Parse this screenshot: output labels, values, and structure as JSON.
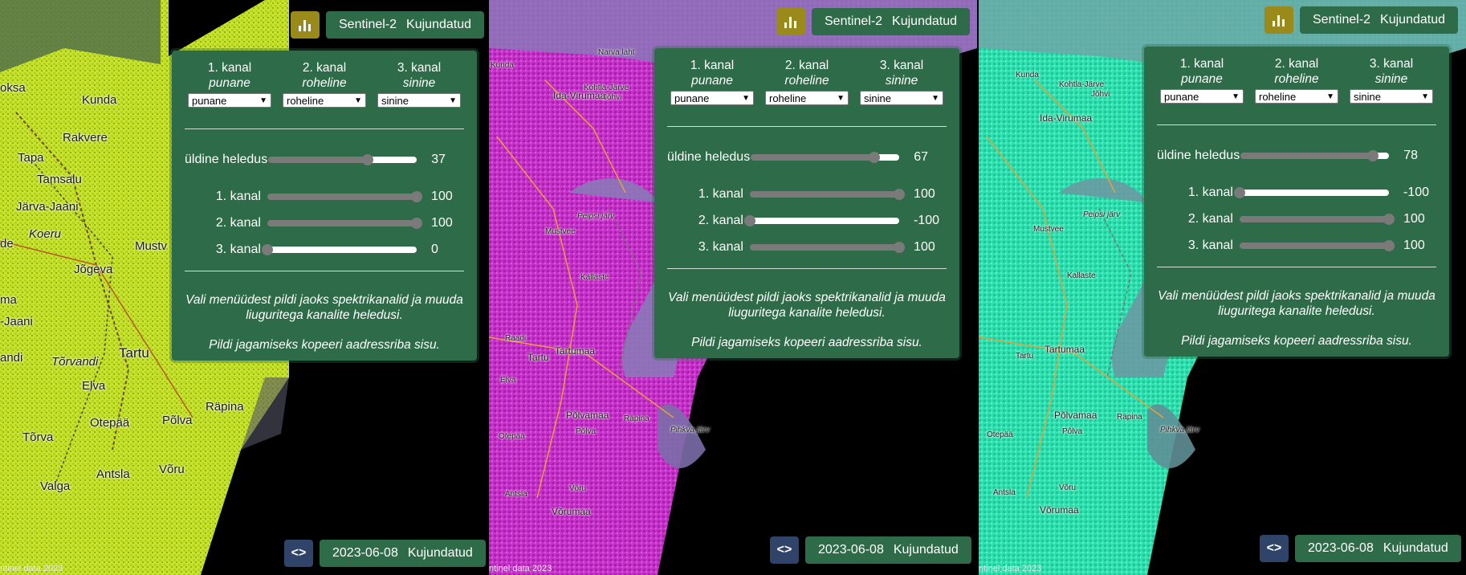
{
  "panels": [
    {
      "top": {
        "sensor": "Sentinel-2",
        "mode": "Kujundatud"
      },
      "bottom": {
        "date": "2023-06-08",
        "mode": "Kujundatud"
      },
      "channels": [
        {
          "title": "1. kanal",
          "name": "punane",
          "selected": "punane"
        },
        {
          "title": "2. kanal",
          "name": "roheline",
          "selected": "roheline"
        },
        {
          "title": "3. kanal",
          "name": "sinine",
          "selected": "sinine"
        }
      ],
      "brightness": {
        "label": "üldine heledus",
        "value": "37",
        "fraction": 0.67
      },
      "sliders": [
        {
          "label": "1. kanal",
          "value": "100",
          "fraction": 1.0
        },
        {
          "label": "2. kanal",
          "value": "100",
          "fraction": 1.0
        },
        {
          "label": "3. kanal",
          "value": "0",
          "fraction": 0.0
        }
      ],
      "desc1": "Vali menüüdest pildi jaoks spektrikanalid ja muuda liuguritega kanalite heledusi.",
      "desc2": "Pildi jagamiseks kopeeri aadressriba sisu.",
      "attribution": "ntinel data 2023",
      "places": [
        "Kunda",
        "Rakvere",
        "oksa",
        "Tapa",
        "Tamsalu",
        "Järva-Jaani",
        "Koeru",
        "Mustv",
        "Jõgeva",
        "Tartu",
        "Tõrvandi",
        "Elva",
        "Põlva",
        "Otepää",
        "Räpina",
        "Tõrva",
        "Antsla",
        "Võru",
        "Valga",
        "ma",
        "-Jaani",
        "andi",
        "de"
      ]
    },
    {
      "top": {
        "sensor": "Sentinel-2",
        "mode": "Kujundatud"
      },
      "bottom": {
        "date": "2023-06-08",
        "mode": "Kujundatud"
      },
      "channels": [
        {
          "title": "1. kanal",
          "name": "punane",
          "selected": "punane"
        },
        {
          "title": "2. kanal",
          "name": "roheline",
          "selected": "roheline"
        },
        {
          "title": "3. kanal",
          "name": "sinine",
          "selected": "sinine"
        }
      ],
      "brightness": {
        "label": "üldine heledus",
        "value": "67",
        "fraction": 0.83
      },
      "sliders": [
        {
          "label": "1. kanal",
          "value": "100",
          "fraction": 1.0
        },
        {
          "label": "2. kanal",
          "value": "-100",
          "fraction": 0.0
        },
        {
          "label": "3. kanal",
          "value": "100",
          "fraction": 1.0
        }
      ],
      "desc1": "Vali menüüdest pildi jaoks spektrikanalid ja muuda liuguritega kanalite heledusi.",
      "desc2": "Pildi jagamiseks kopeeri aadressriba sisu.",
      "attribution": "ntinel data 2023",
      "places": [
        "Narva laht",
        "Kunda",
        "Kohtla-Järve",
        "Jõhvi",
        "Ida-Virumaa",
        "Peipsi järv",
        "Mustvee",
        "Kallaste",
        "Tartu",
        "Tartumaa",
        "Põlvamaa",
        "Põlva",
        "Räpina",
        "Otepää",
        "Võru",
        "Võrumaa",
        "Antsla",
        "Pihkva järv",
        "Raadi",
        "Elva"
      ]
    },
    {
      "top": {
        "sensor": "Sentinel-2",
        "mode": "Kujundatud"
      },
      "bottom": {
        "date": "2023-06-08",
        "mode": "Kujundatud"
      },
      "channels": [
        {
          "title": "1. kanal",
          "name": "punane",
          "selected": "punane"
        },
        {
          "title": "2. kanal",
          "name": "roheline",
          "selected": "roheline"
        },
        {
          "title": "3. kanal",
          "name": "sinine",
          "selected": "sinine"
        }
      ],
      "brightness": {
        "label": "üldine heledus",
        "value": "78",
        "fraction": 0.89
      },
      "sliders": [
        {
          "label": "1. kanal",
          "value": "-100",
          "fraction": 0.0
        },
        {
          "label": "2. kanal",
          "value": "100",
          "fraction": 1.0
        },
        {
          "label": "3. kanal",
          "value": "100",
          "fraction": 1.0
        }
      ],
      "desc1": "Vali menüüdest pildi jaoks spektrikanalid ja muuda liuguritega kanalite heledusi.",
      "desc2": "Pildi jagamiseks kopeeri aadressriba sisu.",
      "attribution": "ntinel data 2023",
      "places": [
        "Kunda",
        "Kohtla-Järve",
        "Jõhvi",
        "Ida-Virumaa",
        "Peipsi järv",
        "Mustvee",
        "Kallaste",
        "Tartu",
        "Tartumaa",
        "Põlvamaa",
        "Põlva",
        "Räpina",
        "Otepää",
        "Võru",
        "Võrumaa",
        "Antsla",
        "Pihkva järv"
      ]
    }
  ],
  "colors": {
    "panel_green": "#2e6b48",
    "chart_btn": "#9a8a1a",
    "code_btn": "#2f4468",
    "map_yellow": "#c6e02a",
    "map_magenta": "#cc2ccc",
    "map_cyan": "#2de6b4"
  },
  "icons": {
    "chart": "bar-chart-icon",
    "code": "code-brackets-icon"
  }
}
